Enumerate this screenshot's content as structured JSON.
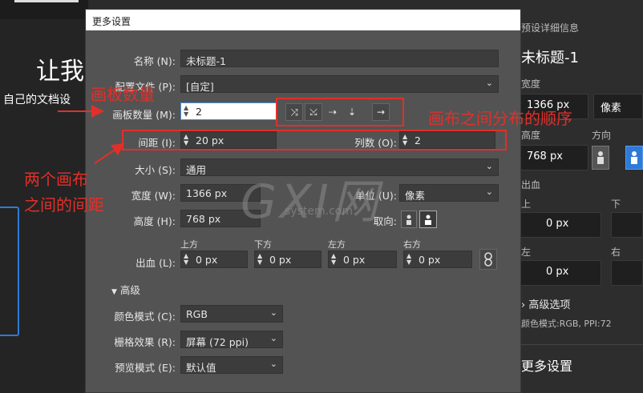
{
  "background": {
    "hero_text": "让我",
    "sub_text": "自己的文档设"
  },
  "right_panel": {
    "preset_details": "预设详细信息",
    "preset_name": "未标题-1",
    "width_label": "宽度",
    "width_value": "1366 px",
    "unit_value": "像素",
    "height_label": "高度",
    "orientation_label": "方向",
    "height_value": "768 px",
    "bleed_label": "出血",
    "top_label": "上",
    "bottom_label": "下",
    "top_value": "0 px",
    "left_label": "左",
    "right_label": "右",
    "left_value": "0 px",
    "advanced_options": "高级选项",
    "color_mode_info": "颜色模式:RGB, PPI:72",
    "more_settings": "更多设置"
  },
  "dialog": {
    "title": "更多设置",
    "name_label": "名称 (N):",
    "name_value": "未标题-1",
    "profile_label": "配置文件 (P):",
    "profile_value": "[自定]",
    "artboards_label": "画板数量 (M):",
    "artboards_value": "2",
    "spacing_label": "间距 (I):",
    "spacing_value": "20 px",
    "columns_label": "列数 (O):",
    "columns_value": "2",
    "size_label": "大小 (S):",
    "size_value": "通用",
    "width_label": "宽度 (W):",
    "width_value": "1366 px",
    "units_label": "单位 (U):",
    "units_value": "像素",
    "height_label": "高度 (H):",
    "height_value": "768 px",
    "orientation_label": "取向:",
    "bleed_label": "出血 (L):",
    "bleed_top_label": "上方",
    "bleed_bottom_label": "下方",
    "bleed_left_label": "左方",
    "bleed_right_label": "右方",
    "bleed_top": "0 px",
    "bleed_bottom": "0 px",
    "bleed_left": "0 px",
    "bleed_right": "0 px",
    "advanced_label": "高级",
    "color_mode_label": "颜色模式 (C):",
    "color_mode_value": "RGB",
    "raster_label": "栅格效果 (R):",
    "raster_value": "屏幕 (72 ppi)",
    "preview_label": "预览模式 (E):",
    "preview_value": "默认值"
  },
  "annotations": {
    "artboard_count": "画板数量",
    "artboard_order": "画布之间分布的顺序",
    "spacing_line1": "两个画布",
    "spacing_line2": "之间的间距"
  },
  "watermark": {
    "logo": "GXI网",
    "site": "system.com"
  },
  "colors": {
    "annotation_red": "#e0302a",
    "accent_blue": "#2f7ad6"
  }
}
